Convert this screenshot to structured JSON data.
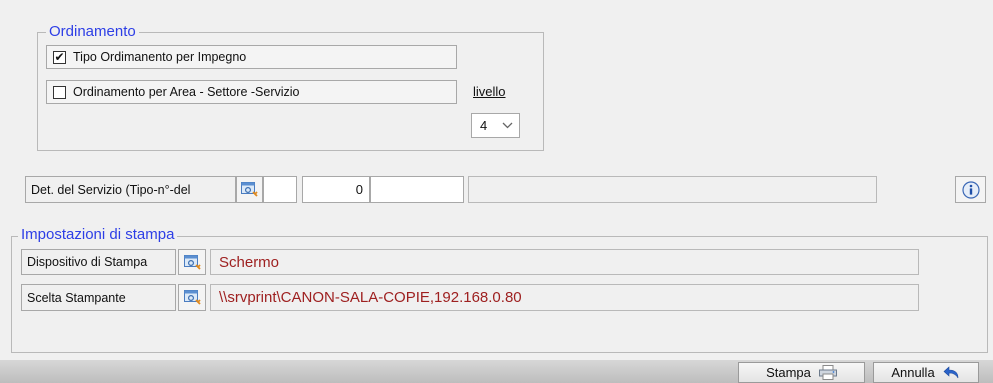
{
  "ordinamento": {
    "title": "Ordinamento",
    "option1": {
      "label": "Tipo Ordimanento per Impegno",
      "checked": true
    },
    "option2": {
      "label": "Ordinamento per Area - Settore -Servizio",
      "checked": false
    },
    "livello_label": "livello",
    "livello_value": "4"
  },
  "det_servizio": {
    "label": "Det. del Servizio (Tipo-n°-del",
    "tipo": "",
    "numero": "0",
    "data": "",
    "descrizione": ""
  },
  "impostazioni": {
    "title": "Impostazioni di stampa",
    "dispositivo_label": "Dispositivo di Stampa",
    "dispositivo_value": "Schermo",
    "stampante_label": "Scelta Stampante",
    "stampante_value": "\\\\srvprint\\CANON-SALA-COPIE,192.168.0.80"
  },
  "buttons": {
    "stampa": "Stampa",
    "annulla": "Annulla"
  },
  "icons": {
    "picker": "search-picker-icon",
    "info": "info-icon",
    "printer": "printer-icon",
    "undo": "undo-icon",
    "dropdown": "chevron-down-icon"
  }
}
